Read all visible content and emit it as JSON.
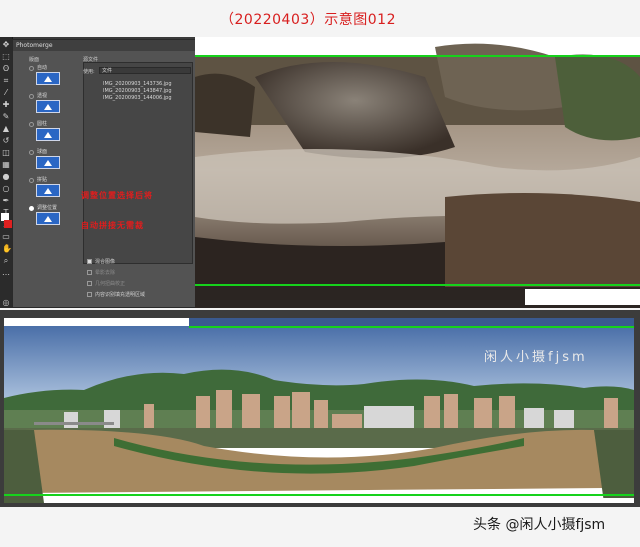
{
  "caption": "（20220403）示意图012",
  "dialog": {
    "title": "Photomerge",
    "layout_label": "版面",
    "layouts": [
      {
        "label": "自动",
        "selected": false
      },
      {
        "label": "透视",
        "selected": false
      },
      {
        "label": "圆柱",
        "selected": false
      },
      {
        "label": "球面",
        "selected": false
      },
      {
        "label": "拼贴",
        "selected": false
      },
      {
        "label": "调整位置",
        "selected": true
      }
    ],
    "source_label": "源文件",
    "use_label": "使用:",
    "use_value": "文件",
    "files": [
      "IMG_20200903_143736.jpg",
      "IMG_20200903_143847.jpg",
      "IMG_20200903_144006.jpg"
    ],
    "options": [
      {
        "label": "混合图像",
        "checked": true,
        "enabled": true
      },
      {
        "label": "晕影去除",
        "checked": false,
        "enabled": false
      },
      {
        "label": "几何扭曲校正",
        "checked": false,
        "enabled": false
      },
      {
        "label": "内容识别填充透明区域",
        "checked": false,
        "enabled": true
      }
    ],
    "notes": [
      "调整位置选择后将",
      "自动拼接无需裁"
    ]
  },
  "watermark": "闲人小摄fjsm",
  "credit": "头条 @闲人小摄fjsm",
  "colors": {
    "caption_red": "#d81e1e",
    "guide_green": "#16d21c",
    "dialog_bg": "#535353",
    "note_red": "#e11d1d"
  }
}
